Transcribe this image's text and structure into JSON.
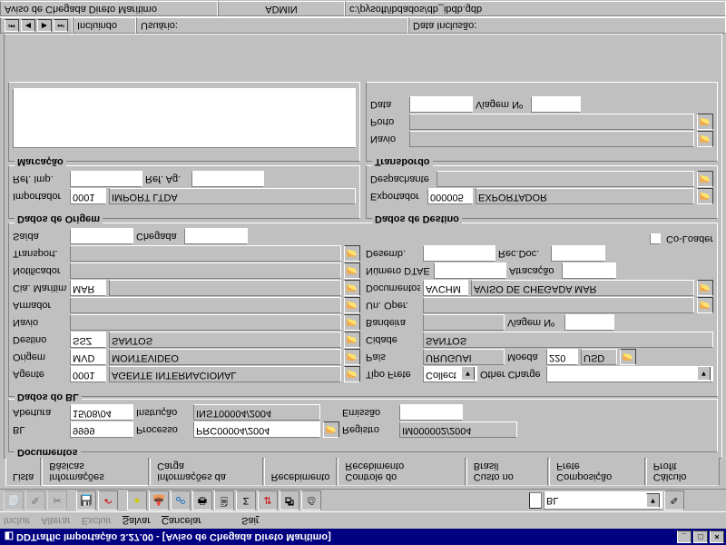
{
  "title": "DDTraffic Importação 3.27.00 - [Aviso de Chegada Direto Marítimo]",
  "menu": {
    "incluir": "Incluir",
    "alterar": "Alterar",
    "excluir": "Excluir",
    "salvar": "Salvar",
    "cancelar": "Cancelar",
    "sair": "Sair"
  },
  "toolbar": {
    "combo_label": "",
    "combo_value": "BL"
  },
  "tabs": [
    "Lista",
    "Informações Básicas",
    "Informações da Carga",
    "Recebimento",
    "Controle do Recebimento",
    "Custo no Brasil",
    "Composição Frete",
    "Cálculo Profit"
  ],
  "documentos": {
    "title": "Documentos",
    "bl_l": "BL",
    "bl": "9999",
    "processo_l": "Processo",
    "processo": "PRC00004/2004",
    "registro_l": "Registro",
    "registro": "IM000002/2004",
    "abertura_l": "Abertura",
    "abertura": "15/08/04",
    "instrucao_l": "Instrução",
    "instrucao": "INST00004/2004",
    "emissao_l": "Emissão",
    "emissao": ""
  },
  "dados_bl": {
    "title": "Dados do BL",
    "agente_l": "Agente",
    "agente_code": "0001",
    "agente": "AGENTE INTERNACIONAL",
    "tipofrete_l": "Tipo Frete",
    "tipofrete": "Collect",
    "othercharge_l": "Other Charge",
    "othercharge": "",
    "origem_l": "Origem",
    "origem_code": "MVD",
    "origem": "MONTEVIDEO",
    "pais_l": "País",
    "pais": "URUGUAI",
    "moeda_l": "Moeda",
    "moeda_code": "220",
    "moeda": "USD",
    "destino_l": "Destino",
    "destino_code": "SSZ",
    "destino": "SANTOS",
    "cidade_l": "Cidade",
    "cidade": "SANTOS",
    "navio_l": "Navio",
    "navio": "",
    "bandeira_l": "Bandeira",
    "bandeira": "",
    "viagem_l": "Viagem Nº",
    "viagem": "",
    "armador_l": "Armador",
    "armador": "",
    "unoper_l": "Un. Oper.",
    "unoper": "",
    "ciamar_l": "Cia. Marítima",
    "ciamar": "MAR",
    "documentos_l": "Documentos",
    "documentos_code": "AVCHM",
    "documentos": "AVISO DE CHEGADA MAR",
    "notificador_l": "Notificador",
    "notificador": "",
    "numdtae_l": "Número DTAE",
    "numdtae": "",
    "atracacao_l": "Atracação",
    "atracacao": "",
    "transport_l": "Transport.",
    "transport": "",
    "desemb_l": "Desemb.",
    "desemb": "",
    "recdoc_l": "Rec.Doc.",
    "recdoc": "",
    "saida_l": "Saída",
    "saida": "",
    "chegada_l": "Chegada",
    "chegada": "",
    "coloader_l": "Co-Loader"
  },
  "origem_box": {
    "title": "Dados de Origem",
    "importador_l": "Importador",
    "importador_code": "0001",
    "importador": "IMPORT LTDA",
    "refimp_l": "Ref. Imp.",
    "refimp": "",
    "refag_l": "Ref. Ag.",
    "refag": ""
  },
  "destino_box": {
    "title": "Dados de Destino",
    "exportador_l": "Exportador",
    "exportador_code": "000005",
    "exportador": "EXPORTADOR",
    "despachante_l": "Despachante",
    "despachante": ""
  },
  "marcacao": {
    "title": "Marcação"
  },
  "transbordo": {
    "title": "Transbordo",
    "navio_l": "Navio",
    "navio": "",
    "porto_l": "Porto",
    "porto": "",
    "data_l": "Data",
    "data": "",
    "viagem_l": "Viagem Nº",
    "viagem": ""
  },
  "status1": {
    "doc": "Aviso de Chegada Direto Marítimo",
    "user": "ADMIN",
    "path": "c:/pysoft/ibdados/db_ibdb.gdb"
  },
  "status2": {
    "incluindo": "Incluindo",
    "usuario_l": "Usuário:",
    "usuario": "",
    "datainc_l": "Data Inclusão:",
    "datainc": ""
  }
}
